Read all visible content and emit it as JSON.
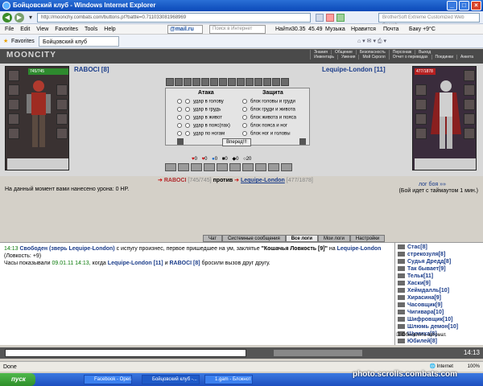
{
  "window": {
    "title": "Бойцовский клуб - Windows Internet Explorer",
    "url": "http://moonchy.combats.com/buttons.pl?battle=0.711033081968969",
    "search_placeholder": "BrotherSoft Extreme Customized Web Search"
  },
  "menu": {
    "items": [
      "File",
      "Edit",
      "View",
      "Favorites",
      "Tools",
      "Help"
    ],
    "mailru": "@mail.ru",
    "search_placeholder": "Поиск в Интернет",
    "find": "Найти",
    "weather": "30.35",
    "temp": "45.49",
    "city": "Баку +9°C",
    "music": "Музыка",
    "likes": "Нравится",
    "mail": "Почта"
  },
  "favorites": {
    "label": "Favorites",
    "tab_title": "Бойцовский клуб"
  },
  "game": {
    "logo": "MOONCITY",
    "top_nav": [
      "Знания",
      "Общение",
      "Безопасность",
      "Персонаж",
      "Выход"
    ],
    "sub_nav": [
      "Инвентарь",
      "Умения",
      "Мой Скролл",
      "Отчет о переводах",
      "Поединки",
      "Анкета"
    ]
  },
  "fight": {
    "player_left": "RABOCI [8]",
    "player_left_hp": "745/745",
    "player_right": "Lequipe-London [11]",
    "player_right_hp": "477/1878",
    "attack_header": "Атака",
    "defense_header": "Защита",
    "attack_options": [
      "удар в голову",
      "удар в грудь",
      "удар в живот",
      "удар в пояс(пах)",
      "удар по ногам"
    ],
    "defense_options": [
      "блок головы и груди",
      "блок груди и живота",
      "блок живота и пояса",
      "блок пояса и ног",
      "блок ног и головы"
    ],
    "go_button": "Вперед!!!",
    "counters": [
      "0",
      "0",
      "0",
      "0",
      "0",
      "20"
    ],
    "vs_left": "RABOCI",
    "vs_left_hp": "[745/745]",
    "vs_word": "против",
    "vs_right": "Lequipe-London",
    "vs_right_hp": "[477/1878]"
  },
  "status": {
    "damage_text": "На данный момент вами нанесено урона: 0 HP.",
    "log_title": "лог боя »»",
    "timeout_text": "(Бой идет с таймаутом 1 мин.)"
  },
  "chat": {
    "tabs": [
      "Чат",
      "Системные сообщения",
      "Все логи",
      "Мои логи",
      "Настройки"
    ],
    "active_tab": "Все логи",
    "time1": "14:13",
    "line1_a": "Свободен (зверь Lequipe-London)",
    "line1_b": "с испугу произнес, первое пришедшее на ум, заклятье",
    "line1_spell": "\"Кошачья Ловкость [9]\"",
    "line1_c": "на",
    "line1_d": "Lequipe-London",
    "line1_e": "(Ловкость: +9)",
    "line2_a": "Часы показывали",
    "line2_date": "09.01.11 14:13,",
    "line2_b": "когда",
    "line2_p1": "Lequipe-London [11]",
    "line2_c": "и",
    "line2_p2": "RABOCI [8]",
    "line2_d": "бросили вызов друг другу."
  },
  "userlist": {
    "users": [
      "Стас[8]",
      "стрекозуля[8]",
      "Судья Дредд[8]",
      "Так бывает[9]",
      "Тельк[11]",
      "Хаски[9]",
      "Хеймдалль[10]",
      "Хирасина[9]",
      "Часовщик[9]",
      "Чигивара[10]",
      "Шифровщик[10]",
      "Шлюмь демон[10]",
      "Шумиха[8]",
      "Юбилей[8]"
    ],
    "auto_update": "Обновлять автомат."
  },
  "bottom": {
    "clock": "14:13"
  },
  "statusbar": {
    "left": "Done",
    "zone": "Internet",
    "zoom": "100%"
  },
  "taskbar": {
    "start": "пуск",
    "tasks": [
      "Facebook - Opera",
      "Бойцовский клуб -...",
      "1.gam - Блокнот"
    ],
    "active_task": "Бойцовский клуб -..."
  },
  "watermark": "photo.scrolls.combats.com"
}
